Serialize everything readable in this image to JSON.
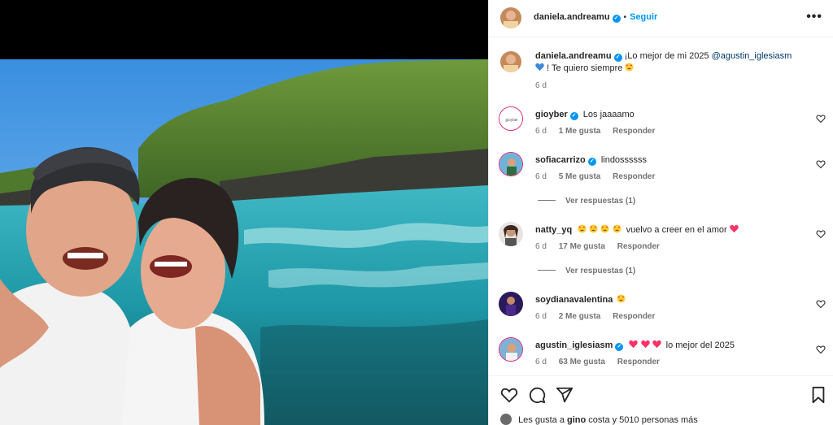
{
  "post": {
    "author": "daniela.andreamu",
    "follow_label": "Seguir",
    "separator": "•",
    "more_label": "•••"
  },
  "caption": {
    "username": "daniela.andreamu",
    "text_start": "¡Lo mejor de mi 2025",
    "mention": "@agustin_iglesiasm",
    "text_end": "! Te quiero siempre",
    "time": "6 d"
  },
  "comments": [
    {
      "username": "gioyber",
      "verified": true,
      "text": "Los jaaaamo",
      "time": "6 d",
      "likes": "1 Me gusta",
      "reply": "Responder"
    },
    {
      "username": "sofiacarrizo",
      "verified": true,
      "text": "lindossssss",
      "time": "6 d",
      "likes": "5 Me gusta",
      "reply": "Responder",
      "view_replies": "Ver respuestas (1)"
    },
    {
      "username": "natty_yq",
      "verified": false,
      "text": "vuelvo a creer en el amor",
      "time": "6 d",
      "likes": "17 Me gusta",
      "reply": "Responder",
      "view_replies": "Ver respuestas (1)"
    },
    {
      "username": "soydianavalentina",
      "verified": false,
      "text": "",
      "time": "6 d",
      "likes": "2 Me gusta",
      "reply": "Responder"
    },
    {
      "username": "agustin_iglesiasm",
      "verified": true,
      "text": "lo mejor del 2025",
      "time": "6 d",
      "likes": "63 Me gusta",
      "reply": "Responder"
    }
  ],
  "liked_by": {
    "prefix": "Les gusta a",
    "user": "gino",
    "suffix": "costa y 5010 personas más"
  },
  "colors": {
    "accent": "#0095f6",
    "heart": "#ff3366",
    "blue_heart": "#3d8bd9"
  },
  "icons": [
    "ellipsis-icon",
    "verified-icon",
    "heart-icon",
    "comment-icon",
    "share-icon",
    "bookmark-icon"
  ]
}
